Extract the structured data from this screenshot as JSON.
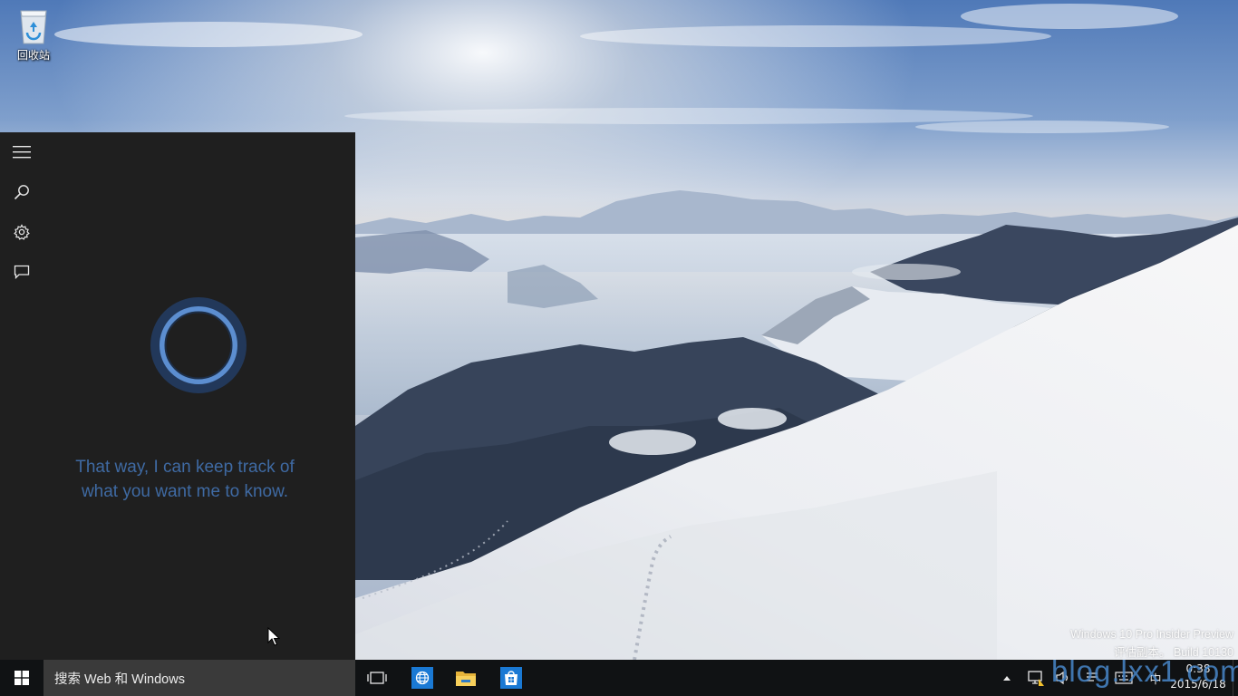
{
  "desktop": {
    "recycle_bin_label": "回收站",
    "wallpaper": "snowy-mountain-landscape"
  },
  "cortana": {
    "message_line1": "That way, I can keep track of",
    "message_line2": "what you want me to know.",
    "rail_icons": [
      "hamburger-menu-icon",
      "search-icon",
      "gear-icon",
      "feedback-icon"
    ],
    "accent_color": "#3f6aa3",
    "panel_color": "#1f1f1f"
  },
  "watermark": {
    "line1": "Windows 10 Pro Insider Preview",
    "line2": "评估副本。 Build 10130"
  },
  "taskbar": {
    "search_placeholder": "搜索 Web 和 Windows",
    "pinned": [
      "task-view-icon",
      "internet-explorer-icon",
      "file-explorer-icon",
      "store-icon"
    ],
    "tray_icons": [
      "show-hidden-icons-chevron",
      "network-icon",
      "volume-icon",
      "action-center-icon",
      "keyboard-icon"
    ],
    "ime_label": "中",
    "clock_time": "0:38",
    "clock_date": "2015/6/18"
  },
  "overlay": {
    "blog_watermark": "blog.lxx1.com"
  }
}
